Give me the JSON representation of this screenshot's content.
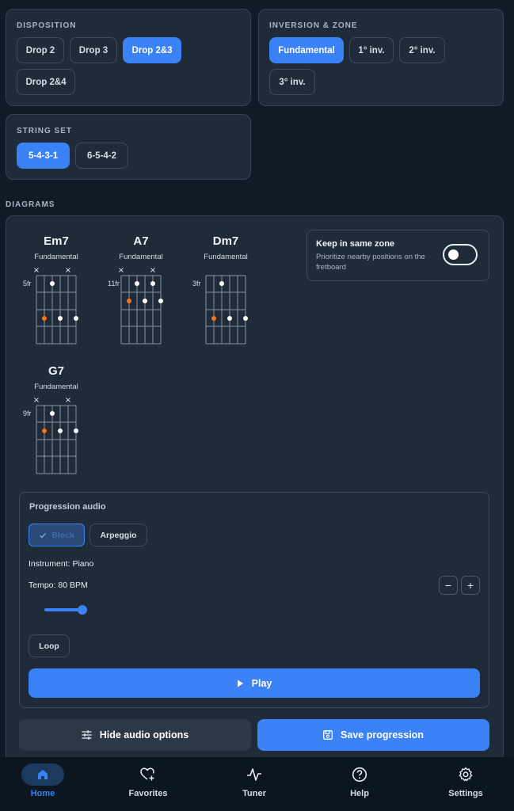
{
  "disposition": {
    "title": "DISPOSITION",
    "options": [
      "Drop 2",
      "Drop 3",
      "Drop 2&3",
      "Drop 2&4"
    ],
    "selected": "Drop 2&3"
  },
  "inversion": {
    "title": "INVERSION & ZONE",
    "options": [
      "Fundamental",
      "1° inv.",
      "2° inv.",
      "3° inv."
    ],
    "selected": "Fundamental"
  },
  "string_set": {
    "title": "STRING SET",
    "options": [
      "5-4-3-1",
      "6-5-4-2"
    ],
    "selected": "5-4-3-1"
  },
  "diagrams": {
    "title": "DIAGRAMS",
    "chords": [
      {
        "name": "Em7",
        "inversion": "Fundamental",
        "fret": "5fr"
      },
      {
        "name": "A7",
        "inversion": "Fundamental",
        "fret": "11fr"
      },
      {
        "name": "Dm7",
        "inversion": "Fundamental",
        "fret": "3fr"
      },
      {
        "name": "G7",
        "inversion": "Fundamental",
        "fret": "9fr"
      }
    ],
    "mute_symbol": "×",
    "keep_zone": {
      "title": "Keep in same zone",
      "description": "Prioritize nearby positions on the fretboard",
      "enabled": false
    }
  },
  "audio": {
    "title": "Progression audio",
    "modes": [
      "Block",
      "Arpeggio"
    ],
    "selected_mode": "Block",
    "instrument": "Instrument: Piano",
    "tempo": "Tempo: 80 BPM",
    "tempo_level": 0.55,
    "minus": "−",
    "plus": "+",
    "loop": "Loop",
    "play": "Play"
  },
  "actions": {
    "hide_audio": "Hide audio options",
    "save": "Save progression"
  },
  "nav": {
    "items": [
      "Home",
      "Favorites",
      "Tuner",
      "Help",
      "Settings"
    ],
    "active": "Home"
  },
  "colors": {
    "accent": "#3b82f6",
    "root_dot": "#f97316",
    "card": "#1f2b38",
    "background": "#0f1c27"
  }
}
